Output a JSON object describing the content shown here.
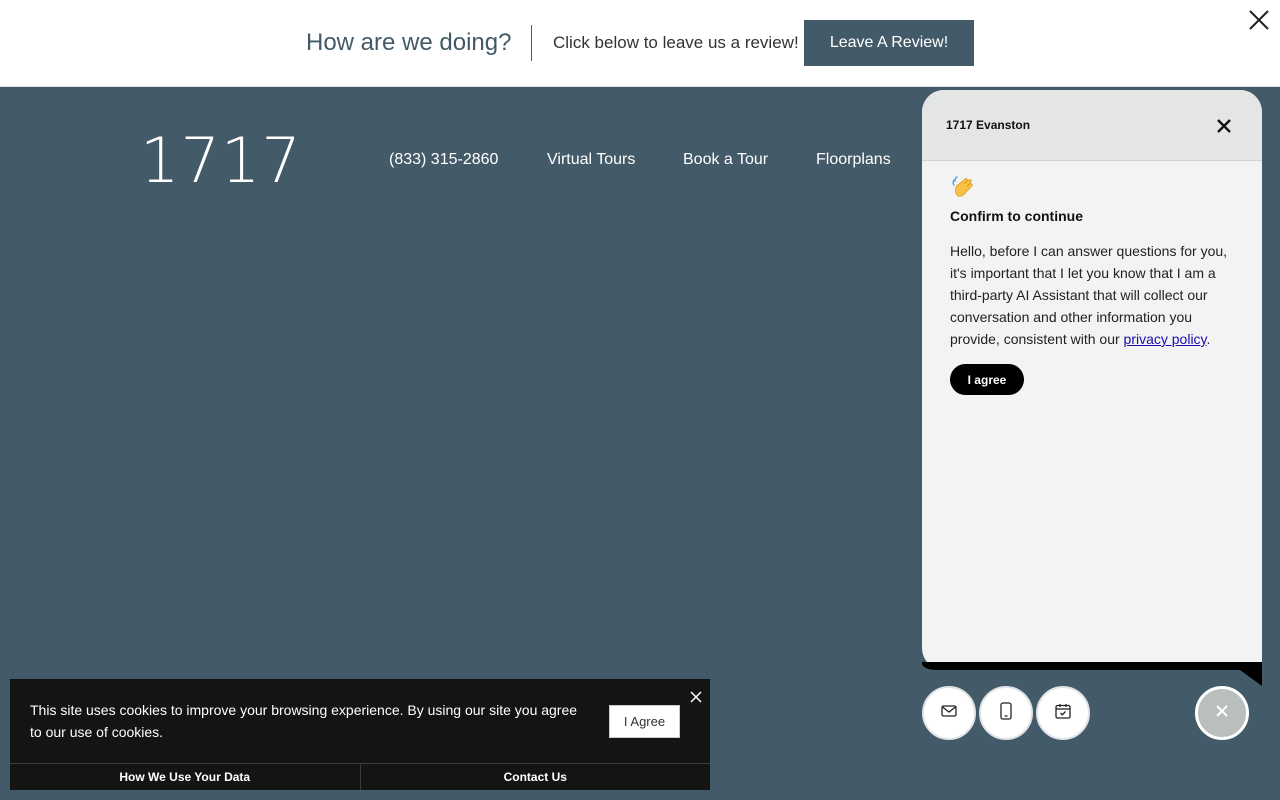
{
  "banner": {
    "question": "How are we doing?",
    "prompt": "Click below to leave us a review!",
    "button": "Leave A Review!",
    "close_icon": "close-icon"
  },
  "header": {
    "logo": "1717",
    "nav": [
      "(833) 315-2860",
      "Virtual Tours",
      "Book a Tour",
      "Floorplans"
    ]
  },
  "chat": {
    "title": "1717 Evanston",
    "wave_icon": "waving-hand-icon",
    "heading": "Confirm to continue",
    "body_before": "Hello, before I can answer questions for you, it's important that I let you know that I am a third-party AI Assistant that will collect our conversation and other information you provide, consistent with our ",
    "link": "privacy policy",
    "body_after": ".",
    "agree": "I agree",
    "actions": [
      "mail-icon",
      "phone-icon",
      "calendar-icon"
    ],
    "fab_icon": "close-icon"
  },
  "cookie": {
    "text": "This site uses cookies to improve your browsing experience. By using our site you agree to our use of cookies.",
    "agree": "I Agree",
    "links": [
      "How We Use Your Data",
      "Contact Us"
    ]
  },
  "colors": {
    "brand": "#435a68",
    "chat_bg": "#f3f3f3",
    "cookie_bg": "#141414"
  }
}
